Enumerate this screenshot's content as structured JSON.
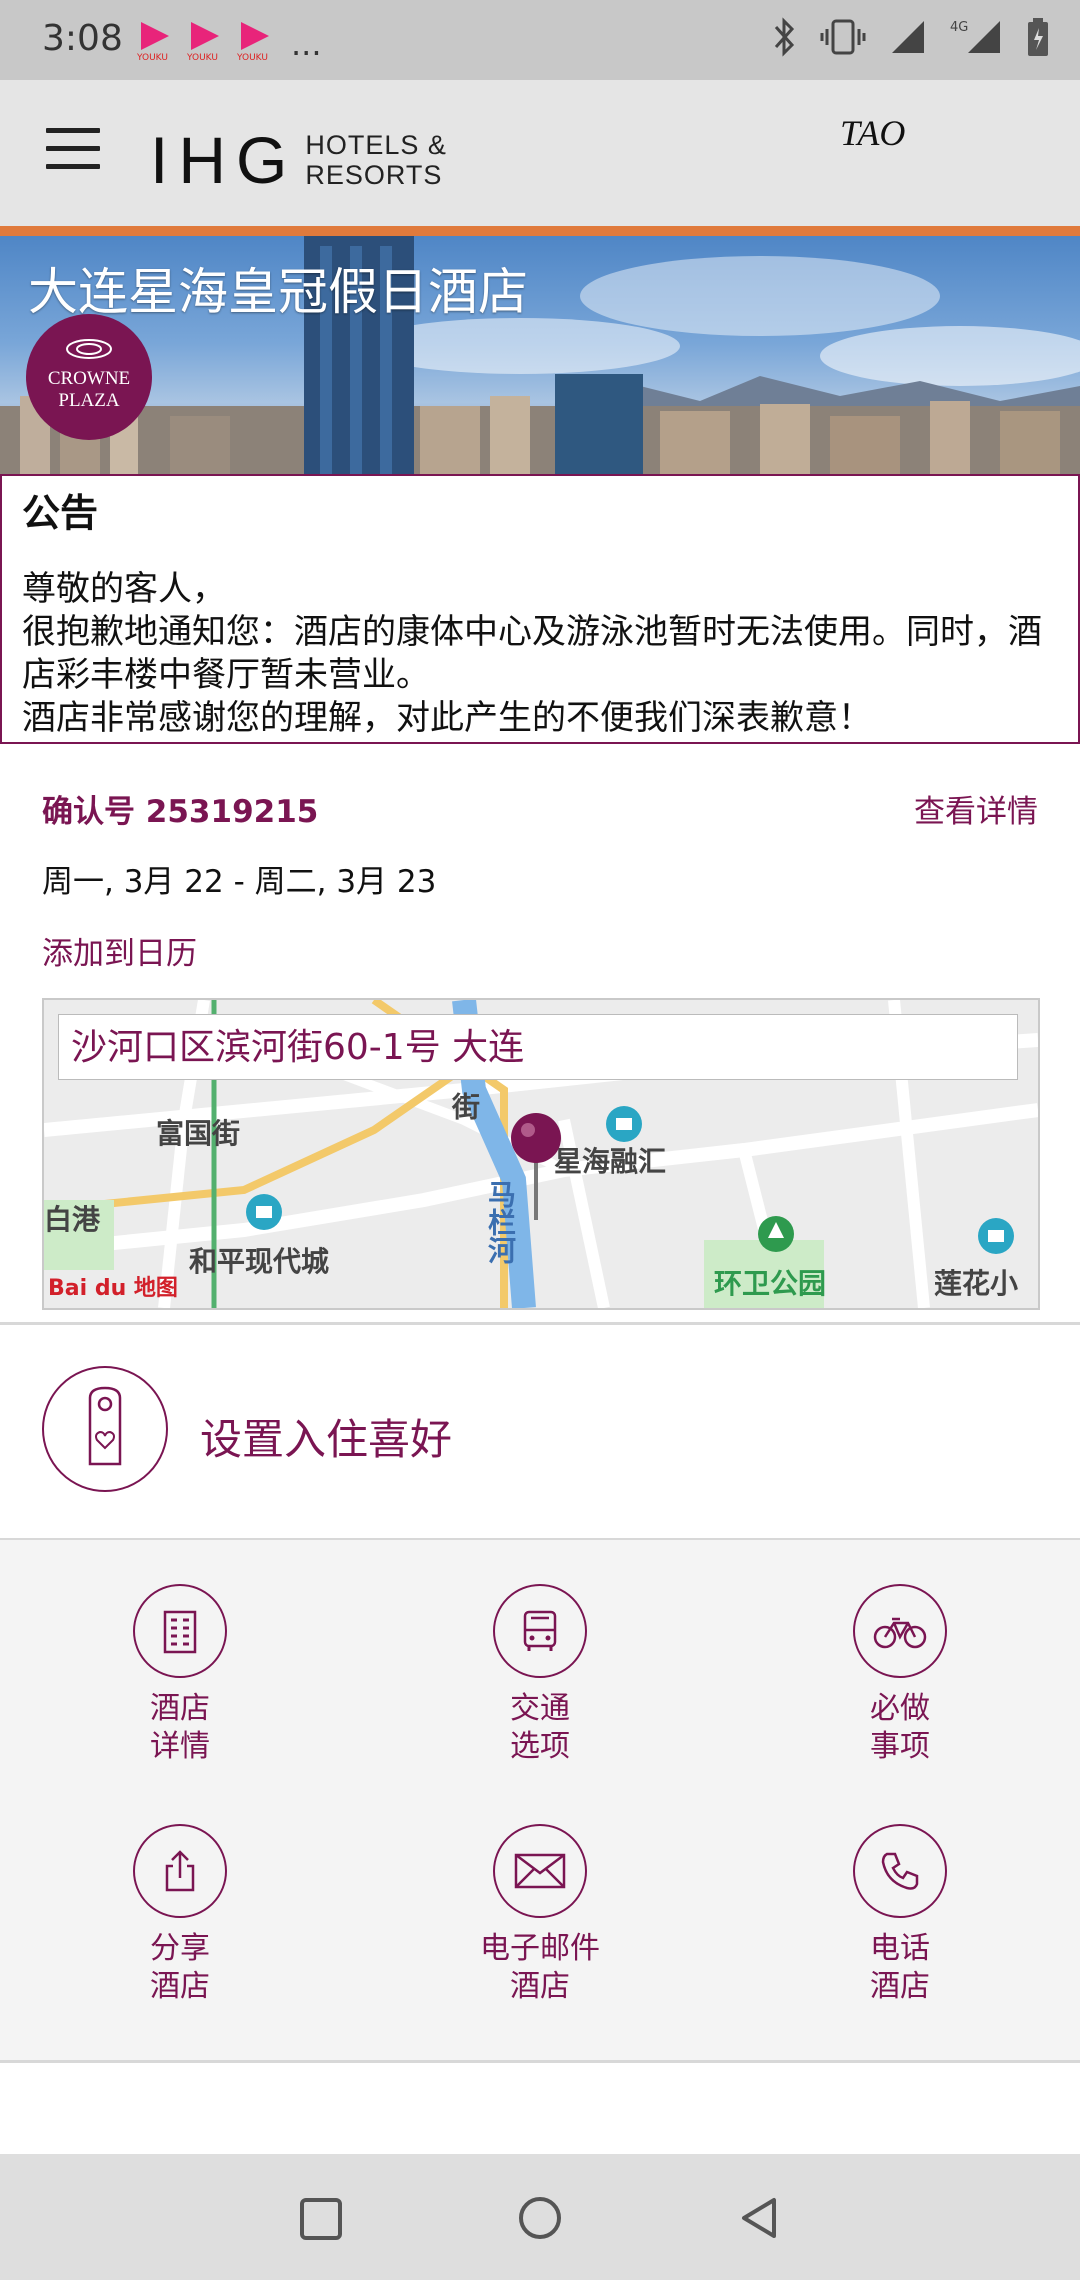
{
  "status_bar": {
    "time": "3:08",
    "app_icons": [
      "youku-icon",
      "youku-icon",
      "youku-icon"
    ],
    "more": "..."
  },
  "header": {
    "logo_main": "IHG",
    "logo_sub_line1": "HOTELS &",
    "logo_sub_line2": "RESORTS",
    "account": "TAO"
  },
  "hotel": {
    "name": "大连星海皇冠假日酒店",
    "brand_line1": "CROWNE",
    "brand_line2": "PLAZA"
  },
  "notice": {
    "title": "公告",
    "line1": "尊敬的客人，",
    "line2": "很抱歉地通知您：酒店的康体中心及游泳池暂时无法使用。同时，酒店彩丰楼中餐厅暂未营业。",
    "line3": "酒店非常感谢您的理解，对此产生的不便我们深表歉意！"
  },
  "booking": {
    "confirmation": "确认号 25319215",
    "details_link": "查看详情",
    "dates": "周一, 3月 22 - 周二, 3月 23",
    "add_calendar": "添加到日历"
  },
  "map": {
    "address": "沙河口区滨河街60-1号 大连",
    "labels": {
      "l1": "富国街",
      "l2": "星海融汇",
      "l3": "白港",
      "l4": "和平现代城",
      "l5": "环卫公园",
      "l6": "莲花小",
      "l7": "马栏河",
      "l8": "街",
      "baidu": "Bai du 地图"
    }
  },
  "preferences": {
    "label": "设置入住喜好"
  },
  "actions": [
    {
      "label": "酒店\n详情",
      "icon": "building-icon"
    },
    {
      "label": "交通\n选项",
      "icon": "bus-icon"
    },
    {
      "label": "必做\n事项",
      "icon": "bicycle-icon"
    },
    {
      "label": "分享\n酒店",
      "icon": "share-icon"
    },
    {
      "label": "电子邮件\n酒店",
      "icon": "mail-icon"
    },
    {
      "label": "电话\n酒店",
      "icon": "phone-icon"
    }
  ],
  "colors": {
    "brand": "#7a1552",
    "accent": "#e07a3c"
  }
}
